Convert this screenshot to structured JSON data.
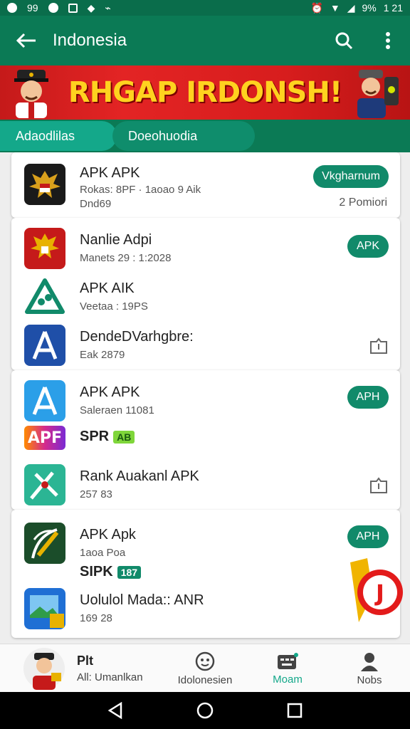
{
  "statusbar": {
    "left_text": "99",
    "battery_text": "9%",
    "time": "1 21"
  },
  "appbar": {
    "title": "Indonesia"
  },
  "banner": {
    "headline": "RHGAP IRDONSH!"
  },
  "tabs": [
    {
      "label": "Adaodlilas"
    },
    {
      "label": "Doeohuodia"
    }
  ],
  "cards": [
    {
      "rows": [
        {
          "name": "APK APK",
          "meta": "Rokas: 8PF · 1aoao 9 Aik",
          "meta2": "Dnd69",
          "button": "Vkgharnum",
          "sub": "2 Pomiori",
          "icon": "garuda-icon"
        }
      ]
    },
    {
      "rows": [
        {
          "name": "Nanlie Adpi",
          "meta": "Manets 29 : 1:2028",
          "button": "APK",
          "icon": "garuda-red-icon"
        },
        {
          "name": "APK AIK",
          "meta": "Veetaa : 19PS",
          "icon": "triangle-leaf-icon"
        },
        {
          "name": "DendeDVarhgbre:",
          "meta": "Eak 2879",
          "icon": "a-store-icon"
        }
      ]
    },
    {
      "rows": [
        {
          "name": "APK APK",
          "meta": "Saleraen 11081",
          "button": "APH",
          "icon": "app-store-icon"
        },
        {
          "name": "SPR",
          "tag": "AB",
          "icon": "apf-logo-icon",
          "icon_text": "APF"
        },
        {
          "name": "Rank Auakanl APK",
          "meta": "257 83",
          "icon": "compass-icon"
        }
      ]
    },
    {
      "rows": [
        {
          "name": "APK Apk",
          "meta": "1aoa Poa",
          "button": "APH",
          "icon": "pen-leaf-icon"
        },
        {
          "name": "SIPK",
          "tag": "187",
          "icon": "none"
        },
        {
          "name": "Uolulol Mada:: ANR",
          "meta": "169 28",
          "icon": "photo-icon"
        }
      ]
    }
  ],
  "bottomnav": [
    {
      "label_top": "Plt",
      "label": "All: Umanlkan",
      "icon": "avatar-police-icon"
    },
    {
      "label": "Idolonesien",
      "icon": "smile-icon"
    },
    {
      "label": "Moam",
      "icon": "keyboard-icon",
      "active": true
    },
    {
      "label": "Nobs",
      "icon": "person-icon"
    }
  ],
  "colors": {
    "primary": "#0b7a55",
    "accent": "#118a6a",
    "banner_red": "#d71d1d",
    "banner_text": "#ffd21f",
    "active_nav": "#14a88a"
  }
}
